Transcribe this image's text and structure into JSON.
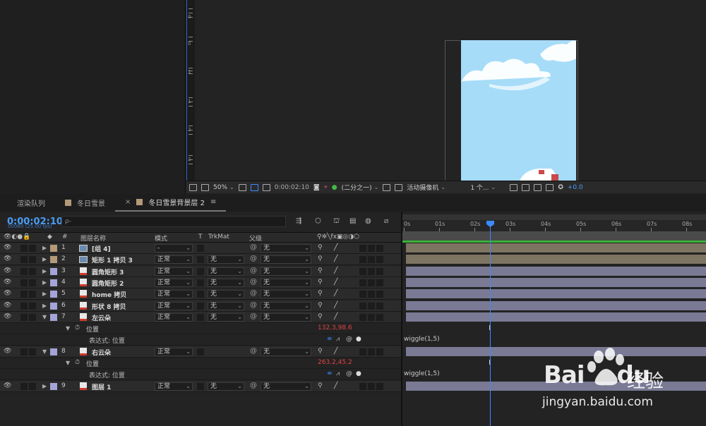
{
  "viewer": {
    "zoom": "50%",
    "timecode": "0:00:02:10",
    "resolution": "(二分之一)",
    "camera": "活动摄像机",
    "views": "1 个...",
    "exposure": "+0.0",
    "ruler_marks": [
      "0",
      "0",
      "1",
      "1",
      "2",
      "2"
    ]
  },
  "tabs": [
    {
      "label": "渲染队列"
    },
    {
      "label": "冬日雪景"
    },
    {
      "label": "冬日雪景背景层 2",
      "active": true
    }
  ],
  "timeline": {
    "current_time": "0:00:02:10",
    "frame_info": "00060 (25.00 fps)",
    "search_placeholder": "ρ-",
    "columns": {
      "number": "#",
      "layer_name": "图层名称",
      "mode": "模式",
      "t": "T",
      "trkmat": "TrkMat",
      "parent": "父级"
    },
    "ruler": [
      "0s",
      "01s",
      "02s",
      "03s",
      "04s",
      "05s",
      "06s",
      "07s",
      "08s"
    ],
    "layers": [
      {
        "num": "1",
        "name": "[组 4]",
        "mode": "-",
        "trkmat": "",
        "parent": "无",
        "color": "#b49a78",
        "type": "precomp"
      },
      {
        "num": "2",
        "name": "矩形 1 拷贝 3",
        "mode": "正常",
        "trkmat": "无",
        "parent": "无",
        "color": "#b49a78",
        "type": "precomp"
      },
      {
        "num": "3",
        "name": "圆角矩形 3",
        "mode": "正常",
        "trkmat": "无",
        "parent": "无",
        "color": "#a4a4d8",
        "type": "file"
      },
      {
        "num": "4",
        "name": "圆角矩形 2",
        "mode": "正常",
        "trkmat": "无",
        "parent": "无",
        "color": "#a4a4d8",
        "type": "file"
      },
      {
        "num": "5",
        "name": "home 拷贝",
        "mode": "正常",
        "trkmat": "无",
        "parent": "无",
        "color": "#a4a4d8",
        "type": "file"
      },
      {
        "num": "6",
        "name": "形状 8 拷贝",
        "mode": "正常",
        "trkmat": "无",
        "parent": "无",
        "color": "#a4a4d8",
        "type": "file"
      },
      {
        "num": "7",
        "name": "左云朵",
        "mode": "正常",
        "trkmat": "无",
        "parent": "无",
        "color": "#a4a4d8",
        "type": "file",
        "expanded": true
      },
      {
        "num": "8",
        "name": "右云朵",
        "mode": "正常",
        "trkmat": "",
        "parent": "无",
        "color": "#a4a4d8",
        "type": "file",
        "expanded": true
      },
      {
        "num": "9",
        "name": "图层 1",
        "mode": "正常",
        "trkmat": "无",
        "parent": "无",
        "color": "#a4a4d8",
        "type": "file"
      }
    ],
    "props": [
      {
        "label": "位置",
        "value": "132.3,98.6",
        "expr_label": "表达式: 位置",
        "expr": "wiggle(1,5)"
      },
      {
        "label": "位置",
        "value": "263.2,45.2",
        "expr_label": "表达式: 位置",
        "expr": "wiggle(1,5)"
      }
    ]
  },
  "watermark": {
    "brand": "Bai",
    "brand2": "du",
    "cn": "经验",
    "url": "jingyan.baidu.com"
  },
  "colors": {
    "accent": "#3a8bff",
    "bar_tan": "#7e7462",
    "bar_blue": "#7a7a95",
    "sky": "#a6dcf8"
  }
}
